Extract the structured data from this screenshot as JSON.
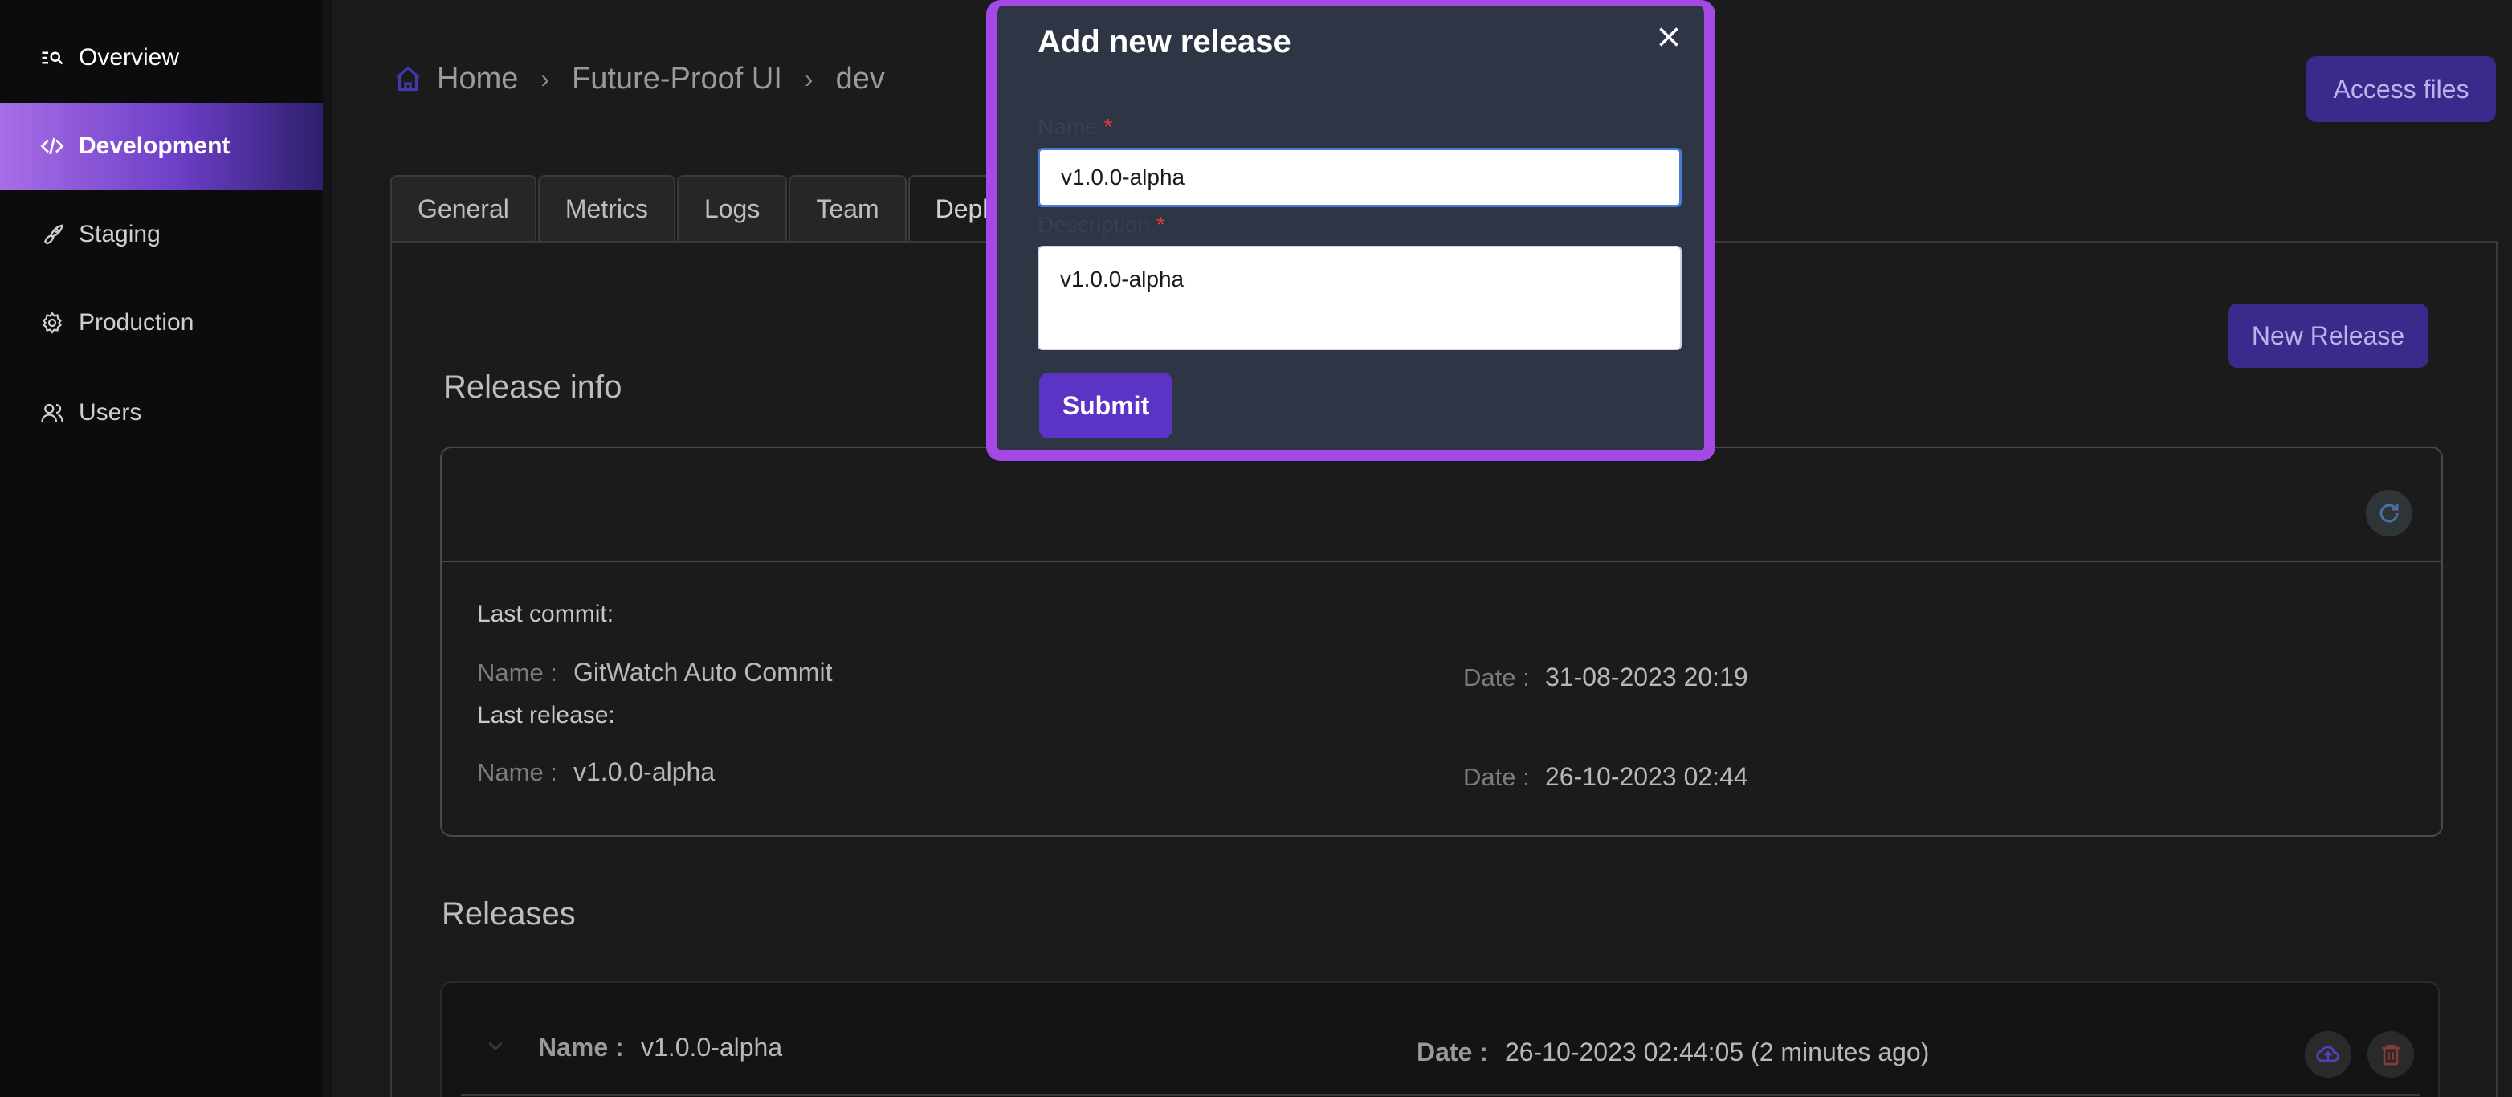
{
  "sidebar": {
    "items": [
      {
        "label": "Overview",
        "icon": "overview-icon"
      },
      {
        "label": "Development",
        "icon": "code-icon"
      },
      {
        "label": "Staging",
        "icon": "rocket-icon"
      },
      {
        "label": "Production",
        "icon": "gear-icon"
      },
      {
        "label": "Users",
        "icon": "users-icon"
      }
    ],
    "active_index": 1
  },
  "breadcrumb": {
    "home": "Home",
    "project": "Future-Proof UI",
    "env": "dev"
  },
  "header": {
    "access_files_label": "Access files"
  },
  "tabs": [
    "General",
    "Metrics",
    "Logs",
    "Team",
    "Deplo"
  ],
  "active_tab_index": 4,
  "release_info": {
    "title": "Release info",
    "new_release_label": "New Release",
    "last_commit_label": "Last commit:",
    "last_commit_name_label": "Name :",
    "last_commit_name": "GitWatch Auto Commit",
    "last_commit_date_label": "Date :",
    "last_commit_date": "31-08-2023 20:19",
    "last_release_label": "Last release:",
    "last_release_name_label": "Name :",
    "last_release_name": "v1.0.0-alpha",
    "last_release_date_label": "Date :",
    "last_release_date": "26-10-2023 02:44"
  },
  "releases": {
    "title": "Releases",
    "rows": [
      {
        "name_label": "Name :",
        "name": "v1.0.0-alpha",
        "date_label": "Date :",
        "date": "26-10-2023 02:44:05 (2 minutes ago)"
      }
    ]
  },
  "modal": {
    "title": "Add new release",
    "name_label": "Name",
    "name_value": "v1.0.0-alpha",
    "description_label": "Description",
    "description_value": "v1.0.0-alpha",
    "required_marker": "*",
    "submit_label": "Submit"
  },
  "colors": {
    "accent": "#a448e6",
    "button": "#5b34c6",
    "sidebar_active_start": "#a86ee8",
    "sidebar_active_end": "#2e1f6e"
  }
}
